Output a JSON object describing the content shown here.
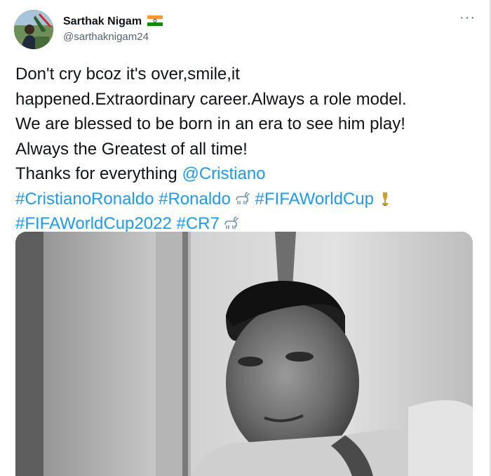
{
  "author": {
    "name": "Sarthak Nigam",
    "handle": "@sarthaknigam24"
  },
  "menu": {
    "label": "···"
  },
  "tweet": {
    "lines": [
      "Don't cry bcoz it's over,smile,it",
      "happened.Extraordinary career.Always a role model.",
      "We are blessed to be born in an era to see him play!",
      "Always the Greatest of all time!"
    ],
    "thanks_text": "Thanks for everything ",
    "mention": "@Cristiano",
    "hashtags": {
      "h1": "#CristianoRonaldo",
      "h2": "#Ronaldo",
      "h3": "#FIFAWorldCup",
      "h4": "#FIFAWorldCup2022",
      "h5": "#CR7"
    }
  },
  "icons": [
    "india-flag-icon",
    "goat-emoji-icon",
    "trophy-emoji-icon",
    "more-options-icon"
  ],
  "colors": {
    "link": "#1d9bf0",
    "text": "#0f1419",
    "handle": "#536471"
  }
}
